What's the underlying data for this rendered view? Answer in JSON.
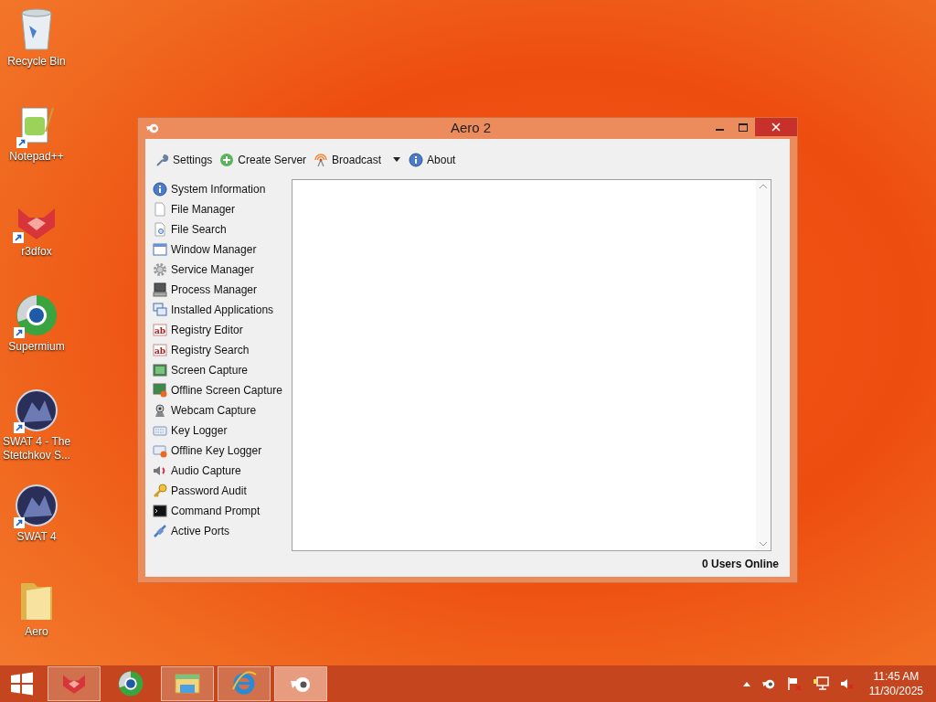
{
  "desktop_icons": [
    {
      "label": "Recycle Bin",
      "kind": "bin",
      "shortcut": false
    },
    {
      "label": "Notepad++",
      "kind": "notepad",
      "shortcut": true
    },
    {
      "label": "r3dfox",
      "kind": "fox",
      "shortcut": true
    },
    {
      "label": "Supermium",
      "kind": "globe",
      "shortcut": true
    },
    {
      "label": "SWAT 4 - The Stetchkov S...",
      "kind": "game",
      "shortcut": true
    },
    {
      "label": "SWAT 4",
      "kind": "game",
      "shortcut": true
    },
    {
      "label": "Aero",
      "kind": "folder",
      "shortcut": false
    }
  ],
  "window": {
    "title": "Aero 2",
    "toolbar": [
      {
        "label": "Settings",
        "kind": "wrench",
        "dropdown": false
      },
      {
        "label": "Create Server",
        "kind": "plus",
        "dropdown": false
      },
      {
        "label": "Broadcast",
        "kind": "signal",
        "dropdown": true
      },
      {
        "label": "About",
        "kind": "info",
        "dropdown": false
      }
    ],
    "sidebar": {
      "items": [
        {
          "label": "System Information",
          "kind": "info"
        },
        {
          "label": "File Manager",
          "kind": "file"
        },
        {
          "label": "File Search",
          "kind": "filesearch"
        },
        {
          "label": "Window Manager",
          "kind": "window"
        },
        {
          "label": "Service Manager",
          "kind": "gear"
        },
        {
          "label": "Process Manager",
          "kind": "computer"
        },
        {
          "label": "Installed Applications",
          "kind": "windows"
        },
        {
          "label": "Registry Editor",
          "kind": "ab"
        },
        {
          "label": "Registry Search",
          "kind": "ab"
        },
        {
          "label": "Screen Capture",
          "kind": "screen"
        },
        {
          "label": "Offline Screen Capture",
          "kind": "screenoff"
        },
        {
          "label": "Webcam Capture",
          "kind": "webcam"
        },
        {
          "label": "Key Logger",
          "kind": "keyboard"
        },
        {
          "label": "Offline Key Logger",
          "kind": "keyboardoff"
        },
        {
          "label": "Audio Capture",
          "kind": "speaker"
        },
        {
          "label": "Password Audit",
          "kind": "key"
        },
        {
          "label": "Command Prompt",
          "kind": "console"
        },
        {
          "label": "Active Ports",
          "kind": "plug"
        }
      ]
    },
    "status_bar": {
      "text": "0 Users Online"
    }
  },
  "taskbar": {
    "items": [
      {
        "kind": "fox",
        "running": true,
        "selected": false
      },
      {
        "kind": "globe",
        "running": false,
        "selected": false
      },
      {
        "kind": "explorer",
        "running": true,
        "selected": false
      },
      {
        "kind": "ie",
        "running": true,
        "selected": false
      },
      {
        "kind": "aero",
        "running": true,
        "selected": true
      }
    ],
    "time": "11:45 AM",
    "date": "11/30/2025"
  }
}
